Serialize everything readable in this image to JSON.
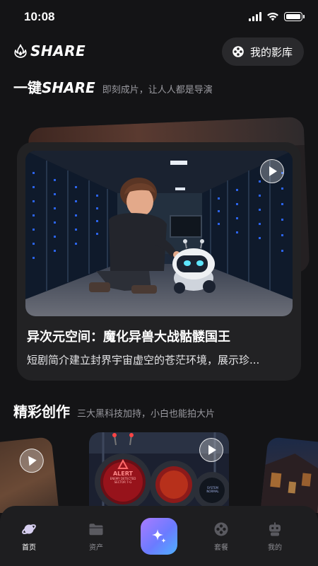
{
  "status_bar": {
    "time": "10:08"
  },
  "header": {
    "logo_text": "SHARE",
    "library_label": "我的影库"
  },
  "hero_section": {
    "title_prefix": "一键",
    "title_en": "SHARE",
    "subtitle": "即刻成片，让人人都是导演"
  },
  "featured": {
    "title": "异次元空间：魔化异兽大战骷髅国王",
    "description": "短剧简介建立封界宇宙虚空的苍茫环境，展示珍..."
  },
  "creations_section": {
    "title": "精彩创作",
    "subtitle": "三大黑科技加持，小白也能拍大片"
  },
  "creation_card": {
    "alert_text": "ALERT",
    "alert_sub_1": "ENEMY DETECTED",
    "alert_sub_2": "SECTOR 7-G",
    "system_text_1": "SYSTEM",
    "system_text_2": "NORMAL"
  },
  "tabs": [
    {
      "label": "首页",
      "icon": "planet-icon",
      "active": true
    },
    {
      "label": "资产",
      "icon": "folder-icon",
      "active": false
    },
    {
      "label": "套餐",
      "icon": "package-icon",
      "active": false
    },
    {
      "label": "我的",
      "icon": "robot-icon",
      "active": false
    }
  ],
  "create_button": {
    "icon": "sparkle-icon"
  },
  "colors": {
    "background": "#141416",
    "card": "#222224",
    "accent_gradient_start": "#a97bff",
    "accent_gradient_end": "#4fb0ff",
    "muted_text": "#9a9aa0"
  }
}
